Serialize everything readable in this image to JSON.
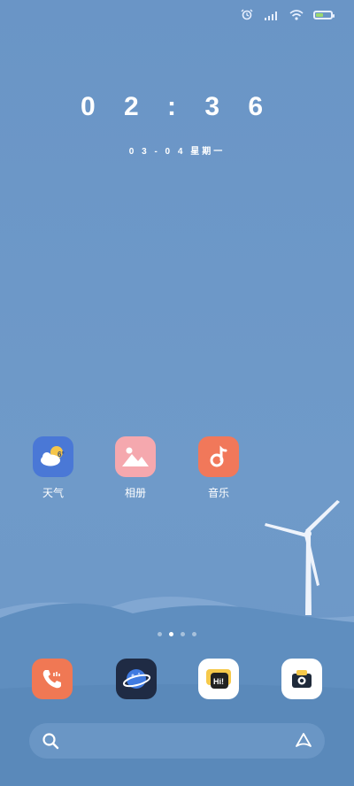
{
  "clock": {
    "time": "0 2 : 3 6"
  },
  "date": {
    "text": "0 3 - 0 4  星期一"
  },
  "status": {
    "battery_level": 0.45
  },
  "apps": [
    {
      "label": "天气",
      "icon": "weather-icon",
      "temp": "6°"
    },
    {
      "label": "相册",
      "icon": "gallery-icon"
    },
    {
      "label": "音乐",
      "icon": "music-icon"
    }
  ],
  "dock": [
    {
      "icon": "phone-icon"
    },
    {
      "icon": "browser-icon"
    },
    {
      "icon": "chat-icon",
      "text": "Hi!"
    },
    {
      "icon": "camera-icon"
    }
  ],
  "pager": {
    "count": 4,
    "active": 2
  },
  "search": {
    "placeholder": ""
  }
}
